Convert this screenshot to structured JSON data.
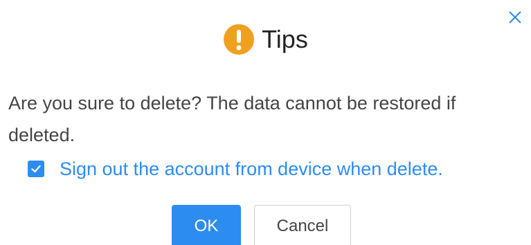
{
  "dialog": {
    "title": "Tips",
    "icon": "warning-icon",
    "message": "Are you sure to delete? The data cannot be restored if deleted.",
    "checkbox": {
      "checked": true,
      "label": "Sign out the account from device when delete."
    },
    "buttons": {
      "ok_label": "OK",
      "cancel_label": "Cancel"
    }
  },
  "colors": {
    "accent": "#2d8cf0",
    "warning": "#f0a020",
    "text": "#444444"
  }
}
